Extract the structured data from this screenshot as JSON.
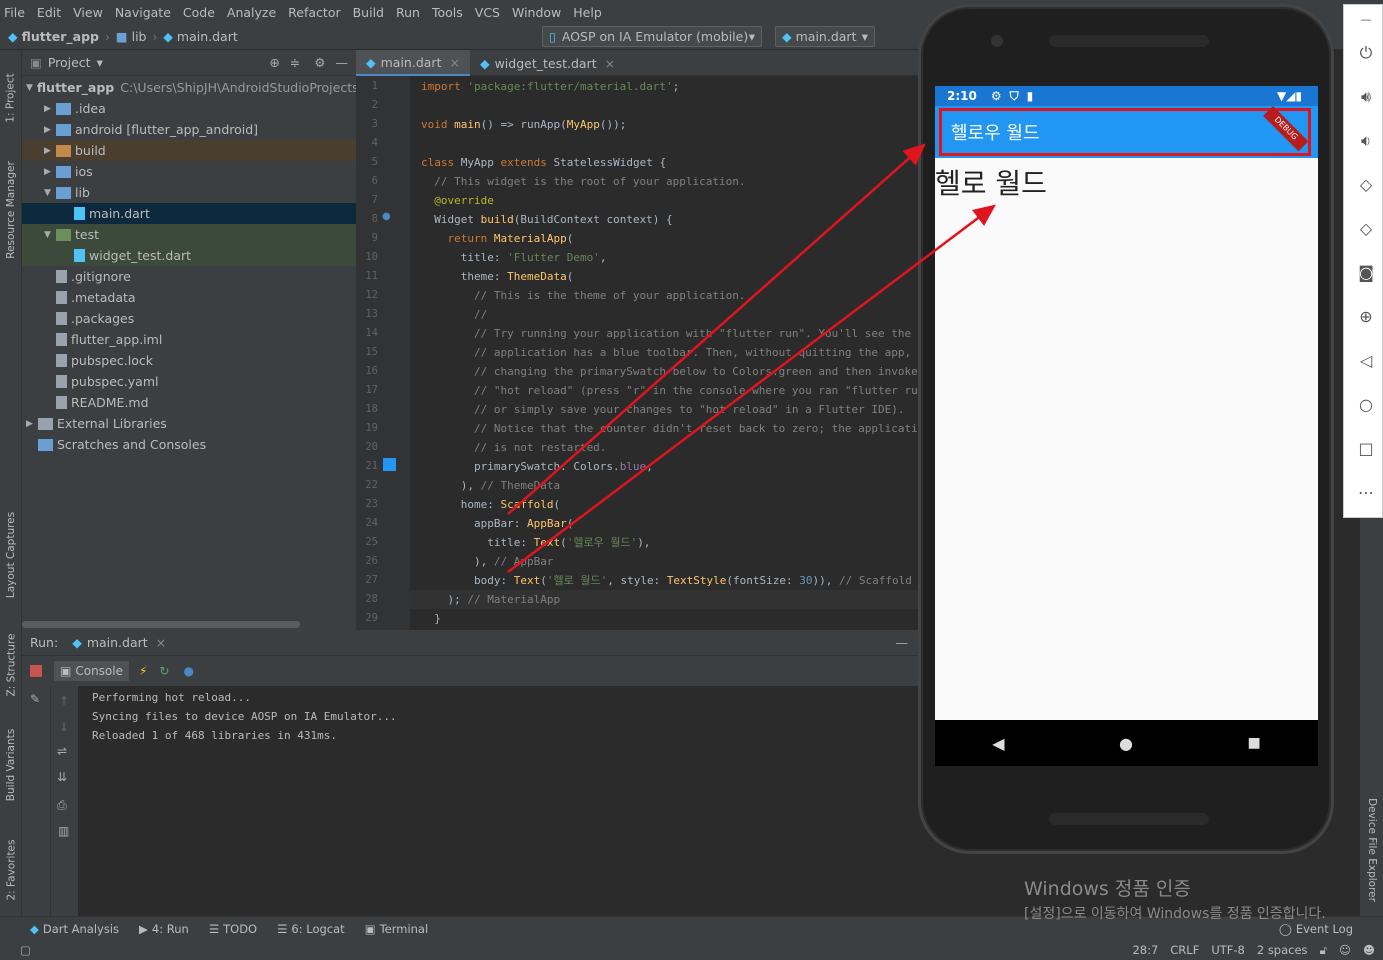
{
  "menu": [
    "File",
    "Edit",
    "View",
    "Navigate",
    "Code",
    "Analyze",
    "Refactor",
    "Build",
    "Run",
    "Tools",
    "VCS",
    "Window",
    "Help"
  ],
  "breadcrumb": [
    "flutter_app",
    "lib",
    "main.dart"
  ],
  "device_selector": "AOSP on IA Emulator (mobile)",
  "run_config": "main.dart",
  "left_tabs": [
    "1: Project",
    "Resource Manager",
    "Layout Captures",
    "Z: Structure",
    "Build Variants",
    "2: Favorites"
  ],
  "project": {
    "header": "Project",
    "root": "flutter_app",
    "root_path": "C:\\Users\\ShipJH\\AndroidStudioProjects\\",
    "items": [
      {
        "label": ".idea",
        "depth": 1,
        "arrow": "▶",
        "type": "folder"
      },
      {
        "label": "android [flutter_app_android]",
        "depth": 1,
        "arrow": "▶",
        "type": "folder"
      },
      {
        "label": "build",
        "depth": 1,
        "arrow": "▶",
        "type": "folder-orange"
      },
      {
        "label": "ios",
        "depth": 1,
        "arrow": "▶",
        "type": "folder"
      },
      {
        "label": "lib",
        "depth": 1,
        "arrow": "▼",
        "type": "folder"
      },
      {
        "label": "main.dart",
        "depth": 2,
        "arrow": "",
        "type": "dart",
        "selected": true
      },
      {
        "label": "test",
        "depth": 1,
        "arrow": "▼",
        "type": "folder-green"
      },
      {
        "label": "widget_test.dart",
        "depth": 2,
        "arrow": "",
        "type": "dart"
      },
      {
        "label": ".gitignore",
        "depth": 1,
        "arrow": "",
        "type": "file"
      },
      {
        "label": ".metadata",
        "depth": 1,
        "arrow": "",
        "type": "file"
      },
      {
        "label": ".packages",
        "depth": 1,
        "arrow": "",
        "type": "file"
      },
      {
        "label": "flutter_app.iml",
        "depth": 1,
        "arrow": "",
        "type": "file"
      },
      {
        "label": "pubspec.lock",
        "depth": 1,
        "arrow": "",
        "type": "file"
      },
      {
        "label": "pubspec.yaml",
        "depth": 1,
        "arrow": "",
        "type": "file"
      },
      {
        "label": "README.md",
        "depth": 1,
        "arrow": "",
        "type": "file"
      },
      {
        "label": "External Libraries",
        "depth": 0,
        "arrow": "▶",
        "type": "lib"
      },
      {
        "label": "Scratches and Consoles",
        "depth": 0,
        "arrow": "",
        "type": "scratch"
      }
    ]
  },
  "editor_tabs": [
    "main.dart",
    "widget_test.dart"
  ],
  "code_lines": [
    [
      [
        "kw",
        "import "
      ],
      [
        "str",
        "'package:flutter/material.dart'"
      ],
      [
        "",
        "; "
      ]
    ],
    [],
    [
      [
        "kw",
        "void "
      ],
      [
        "cls",
        "main"
      ],
      [
        "",
        "() => runApp("
      ],
      [
        "cls",
        "MyApp"
      ],
      [
        "",
        "());"
      ]
    ],
    [],
    [
      [
        "kw",
        "class "
      ],
      [
        "",
        "MyApp "
      ],
      [
        "kw",
        "extends "
      ],
      [
        "",
        "StatelessWidget {"
      ]
    ],
    [
      [
        "cmt",
        "  // This widget is the root of your application."
      ]
    ],
    [
      [
        "ann",
        "  @override"
      ]
    ],
    [
      [
        "",
        "  Widget "
      ],
      [
        "cls",
        "build"
      ],
      [
        "",
        "(BuildContext context) {"
      ]
    ],
    [
      [
        "kw",
        "    return "
      ],
      [
        "cls",
        "MaterialApp"
      ],
      [
        "",
        "("
      ]
    ],
    [
      [
        "",
        "      title: "
      ],
      [
        "str",
        "'Flutter Demo'"
      ],
      [
        "",
        ","
      ]
    ],
    [
      [
        "",
        "      theme: "
      ],
      [
        "cls",
        "ThemeData"
      ],
      [
        "",
        "("
      ]
    ],
    [
      [
        "cmt",
        "        // This is the theme of your application."
      ]
    ],
    [
      [
        "cmt",
        "        //"
      ]
    ],
    [
      [
        "cmt",
        "        // Try running your application with \"flutter run\". You'll see the"
      ]
    ],
    [
      [
        "cmt",
        "        // application has a blue toolbar. Then, without quitting the app, try"
      ]
    ],
    [
      [
        "cmt",
        "        // changing the primarySwatch below to Colors.green and then invoke"
      ]
    ],
    [
      [
        "cmt",
        "        // \"hot reload\" (press \"r\" in the console where you ran \"flutter run\","
      ]
    ],
    [
      [
        "cmt",
        "        // or simply save your changes to \"hot reload\" in a Flutter IDE)."
      ]
    ],
    [
      [
        "cmt",
        "        // Notice that the counter didn't reset back to zero; the application"
      ]
    ],
    [
      [
        "cmt",
        "        // is not restarted."
      ]
    ],
    [
      [
        "",
        "        primarySwatch: Colors."
      ],
      [
        "fld",
        "blue"
      ],
      [
        "",
        ","
      ]
    ],
    [
      [
        "",
        "      ), "
      ],
      [
        "cmt",
        "// ThemeData"
      ]
    ],
    [
      [
        "",
        "      home: "
      ],
      [
        "cls",
        "Scaffold"
      ],
      [
        "",
        "("
      ]
    ],
    [
      [
        "",
        "        appBar: "
      ],
      [
        "cls",
        "AppBar"
      ],
      [
        "",
        "("
      ]
    ],
    [
      [
        "",
        "          title: "
      ],
      [
        "cls",
        "Text"
      ],
      [
        "",
        "("
      ],
      [
        "str",
        "'헬로우 월드'"
      ],
      [
        "",
        "),"
      ]
    ],
    [
      [
        "",
        "        ), "
      ],
      [
        "cmt",
        "// AppBar"
      ]
    ],
    [
      [
        "",
        "        body: "
      ],
      [
        "cls",
        "Text"
      ],
      [
        "",
        "("
      ],
      [
        "str",
        "'헬로 월드'"
      ],
      [
        "",
        ", style: "
      ],
      [
        "cls",
        "TextStyle"
      ],
      [
        "",
        "(fontSize: "
      ],
      [
        "num",
        "30"
      ],
      [
        "",
        ")), "
      ],
      [
        "cmt",
        "// Scaffold"
      ]
    ],
    [
      [
        "",
        "    ); "
      ],
      [
        "cmt",
        "// MaterialApp"
      ]
    ],
    [
      [
        "",
        "  }"
      ]
    ]
  ],
  "run": {
    "label": "Run:",
    "tab": "main.dart",
    "console_tab": "Console",
    "output": [
      "Performing hot reload...",
      "Syncing files to device AOSP on IA Emulator...",
      "Reloaded 1 of 468 libraries in 431ms."
    ]
  },
  "bottom_tabs": [
    "Dart Analysis",
    "4: Run",
    "TODO",
    "6: Logcat",
    "Terminal"
  ],
  "event_log": "Event Log",
  "status": {
    "pos": "28:7",
    "eol": "CRLF",
    "enc": "UTF-8",
    "indent": "2 spaces"
  },
  "right_tab": "Device File Explorer",
  "phone": {
    "time": "2:10",
    "appbar_title": "헬로우 월드",
    "body_text": "헬로 월드",
    "debug": "DEBUG"
  },
  "windows_watermark": {
    "title": "Windows 정품 인증",
    "sub": "[설정]으로 이동하여 Windows를 정품 인증합니다."
  }
}
